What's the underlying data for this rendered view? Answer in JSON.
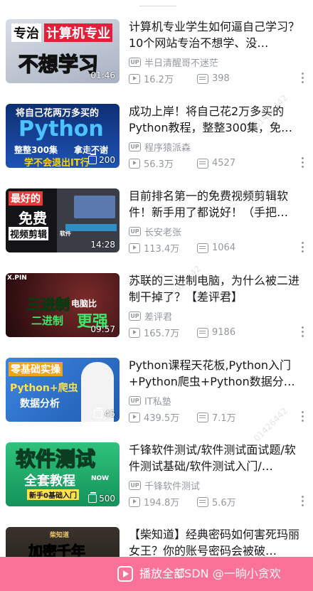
{
  "videos": [
    {
      "title": "计算机专业学生如何逼自己学习？10个网站专治不想学、没…",
      "up": "半日清醒哥不迷茫",
      "views": "16.2万",
      "danmaku": "398",
      "duration": "01:46",
      "thumb_text": [
        "专治",
        "计算机专业",
        "不想学习"
      ],
      "thumb_bg": "#c9ced8"
    },
    {
      "title": "成功上岸！将自己花2万多买的Python教程，整整300集，免…",
      "up": "程序猿派森",
      "views": "56.3万",
      "danmaku": "4527",
      "duration": "200",
      "thumb_text": [
        "将自己花两万多买的",
        "Python",
        "整整300集",
        "拿走不谢",
        "学不会退出IT行"
      ],
      "thumb_bg": "#163f8e"
    },
    {
      "title": "目前排名第一的免费视频剪辑软件！新手用了都说好！（手把…",
      "up": "长安老张",
      "views": "113.4万",
      "danmaku": "1064",
      "duration": "14:28",
      "thumb_text": [
        "最好的",
        "免费",
        "视频剪辑",
        "软件"
      ],
      "thumb_bg": "#1e1e22"
    },
    {
      "title": "苏联的三进制电脑，为什么被二进制干掉了？【差评君】",
      "up": "差评君",
      "views": "165.7万",
      "danmaku": "9186",
      "duration": "09:57",
      "thumb_text": [
        "X.PIN",
        "三进制",
        "电脑比",
        "二进制",
        "更强"
      ],
      "thumb_bg": "#3a1418"
    },
    {
      "title": "Python课程天花板,Python入门+Python爬虫+Python数据分…",
      "up": "IT私塾",
      "views": "439.5万",
      "danmaku": "7.1万",
      "duration": "45",
      "thumb_text": [
        "零基础实操",
        "Python+爬虫",
        "数据分析"
      ],
      "thumb_bg": "#2d6fc9"
    },
    {
      "title": "千锋软件测试/软件测试面试题/软件测试基础/软件测试入门/…",
      "up": "千锋软件测试",
      "views": "194.8万",
      "danmaku": "5.6万",
      "duration": "500",
      "thumb_text": [
        "软件测试",
        "全套教程",
        "NOW",
        "新手0基础入门"
      ],
      "thumb_bg": "#20a86a"
    },
    {
      "title": "【柴知道】经典密码如何害死玛丽女王？你的账号密码会被破…",
      "up": "",
      "views": "",
      "danmaku": "",
      "duration": "",
      "thumb_text": [
        "柴知道",
        "加密千年"
      ],
      "thumb_bg": "#2b2622"
    }
  ],
  "bottom": {
    "play_all": "播放全部",
    "watermark": "CSDN @一晌小贪欢"
  },
  "up_label": "UP",
  "bg_watermark": "01426442",
  "colors": {
    "accent": "#fb7299",
    "meta": "#9499a0"
  }
}
